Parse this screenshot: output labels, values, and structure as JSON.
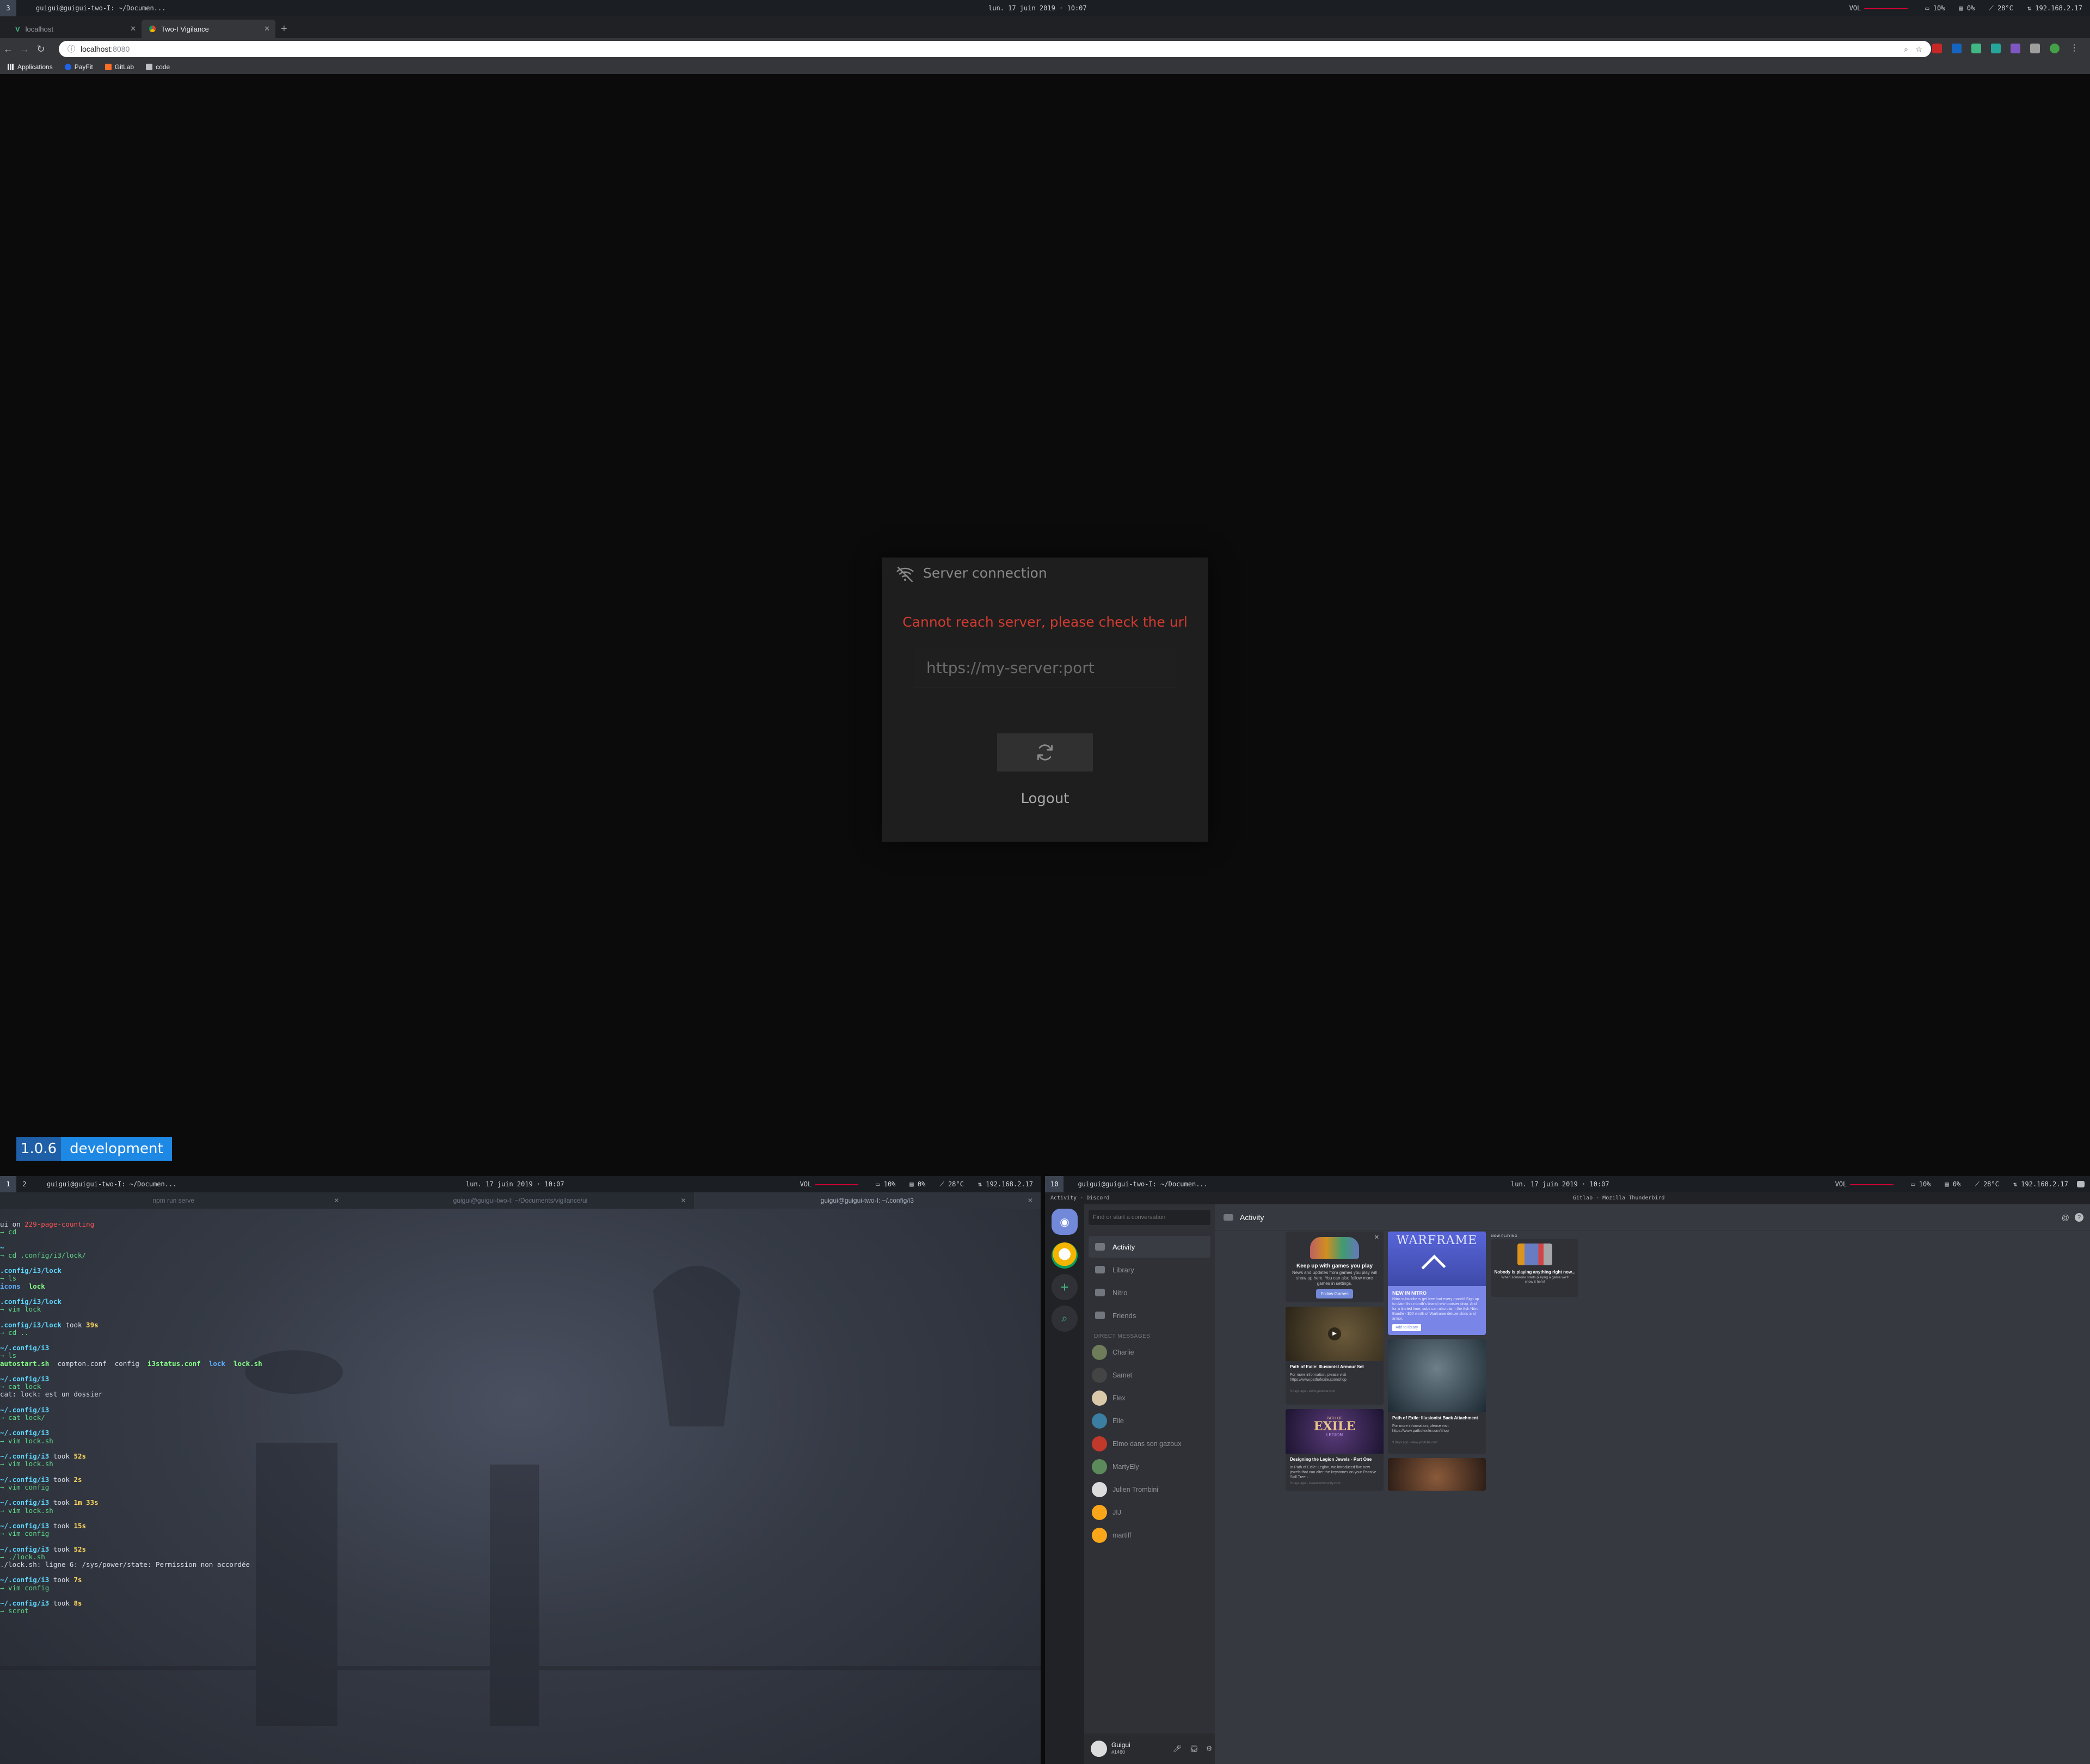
{
  "top_bar": {
    "workspace": "3",
    "window_title": "guigui@guigui-two-I: ~/Documen...",
    "clock": "lun. 17 juin 2019 · 10:07",
    "vol_label": "VOL",
    "cpu": "10%",
    "mem": "0%",
    "temp": "28°C",
    "ip": "192.168.2.17"
  },
  "browser": {
    "tabs": [
      {
        "label": "localhost",
        "icon": "vue-icon"
      },
      {
        "label": "Two-I Vigilance",
        "icon": "chrome-icon"
      }
    ],
    "new_tab": "+",
    "url_host": "localhost",
    "url_port": ":8080",
    "bookmarks": [
      {
        "label": "Applications"
      },
      {
        "label": "PayFit"
      },
      {
        "label": "GitLab"
      },
      {
        "label": "code"
      }
    ]
  },
  "modal": {
    "title": "Server connection",
    "error": "Cannot reach server, please check the url",
    "url_placeholder": "https://my-server:port",
    "logout": "Logout"
  },
  "version_badge": {
    "version": "1.0.6",
    "env": "development"
  },
  "left_bar": {
    "workspaces": [
      "1",
      "2"
    ],
    "window_title": "guigui@guigui-two-I: ~/Documen...",
    "clock": "lun. 17 juin 2019 · 10:07",
    "vol_label": "VOL",
    "cpu": "10%",
    "mem": "0%",
    "temp": "28°C",
    "ip": "192.168.2.17"
  },
  "right_bar": {
    "workspace": "10",
    "window_title": "guigui@guigui-two-I: ~/Documen...",
    "clock": "lun. 17 juin 2019 · 10:07",
    "vol_label": "VOL",
    "cpu": "10%",
    "mem": "0%",
    "temp": "28°C",
    "ip": "192.168.2.17"
  },
  "terminal": {
    "tabs": [
      "npm run serve",
      "guigui@guigui-two-I: ~/Documents/vigilance/ui",
      "guigui@guigui-two-I: ~/.config/i3"
    ]
  },
  "discord": {
    "title_left": "Activity - Discord",
    "title_right": "Gitlab - Mozilla Thunderbird",
    "search_placeholder": "Find or start a conversation",
    "nav": [
      "Activity",
      "Library",
      "Nitro",
      "Friends"
    ],
    "dm_header": "DIRECT MESSAGES",
    "dms": [
      "Charlie",
      "Samet",
      "Flex",
      "Elle",
      "Elmo dans son gazoux",
      "MartyEly",
      "Julien Trombini",
      "JIJ",
      "martiff"
    ],
    "user": {
      "name": "Guigui",
      "tag": "#1460"
    },
    "header": "Activity",
    "now_playing_label": "NOW PLAYING",
    "cards": {
      "follow": {
        "title": "Keep up with games you play",
        "body": "News and updates from games you play will show up here. You can also follow more games in settings.",
        "button": "Follow Games"
      },
      "nitro": {
        "brand": "WARFRAME",
        "label": "NEW IN NITRO",
        "body": "Nitro subscribers get free loot every month! Sign up to claim this month's brand new booster drop. And for a limited time, subs can also claim the Ash Nitro Bundle - $50 worth of Warframe deluxe skins and armor.",
        "button": "Add to library"
      },
      "armour": {
        "title": "Path of Exile: Illusionist Armour Set",
        "body": "For more information, please visit https://www.pathofexile.com/shop",
        "meta": "3 days ago - www.youtube.com"
      },
      "back": {
        "title": "Path of Exile: Illusionist Back Attachment",
        "body": "For more information, please visit https://www.pathofexile.com/shop",
        "meta": "3 days ago - www.youtube.com"
      },
      "legion": {
        "title": "Designing the Legion Jewels - Part One",
        "body": "In Path of Exile: Legion, we introduced five new jewels that can alter the keystones on your Passive Skill Tree i...",
        "meta": "3 days ago - steamcommunity.com",
        "logo_top": "PATH OF",
        "logo_main": "EXILE",
        "logo_sub": "LEGION"
      },
      "now_playing": {
        "title": "Nobody is playing anything right now...",
        "body": "When someone starts playing a game we'll show it here!"
      }
    }
  }
}
